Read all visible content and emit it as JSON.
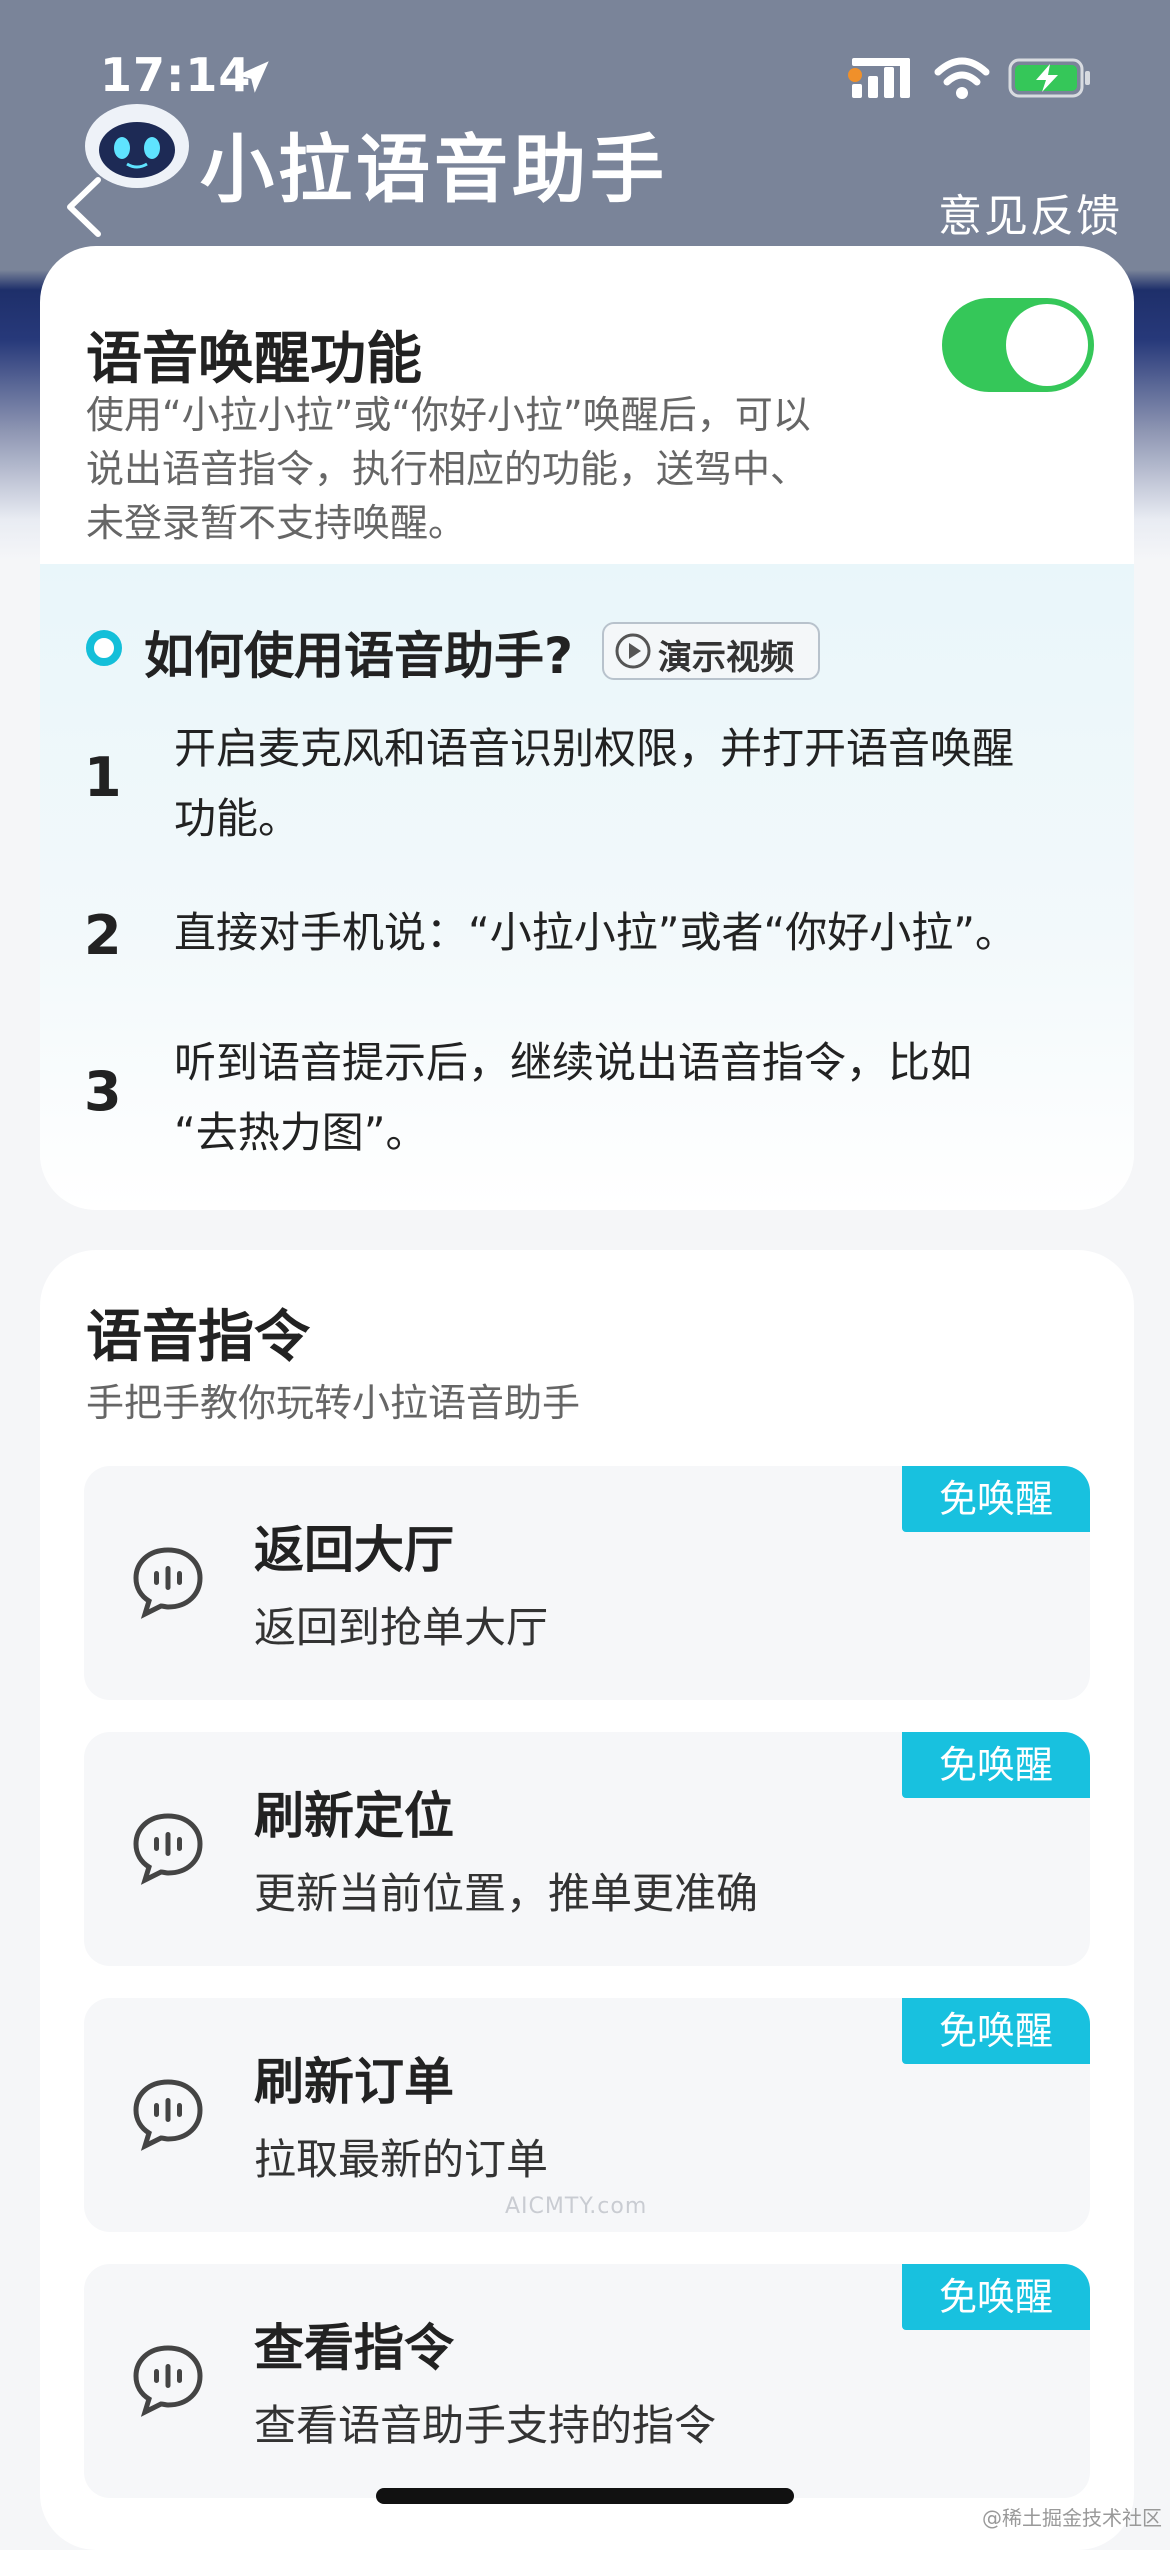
{
  "status_bar": {
    "time": "17:14"
  },
  "header": {
    "title": "小拉语音助手",
    "feedback": "意见反馈"
  },
  "wake": {
    "title": "语音唤醒功能",
    "desc_lines": [
      "使用“小拉小拉”或“你好小拉”唤醒后，可以",
      "说出语音指令，执行相应的功能，送驾中、",
      "未登录暂不支持唤醒。"
    ],
    "enabled": true,
    "toggle_color": "#35c759"
  },
  "howto": {
    "title": "如何使用语音助手?",
    "demo_label": "演示视频",
    "steps": [
      {
        "num": "1",
        "lines": [
          "开启麦克风和语音识别权限，并打开语音唤醒",
          "功能。"
        ]
      },
      {
        "num": "2",
        "lines": [
          "直接对手机说：“小拉小拉”或者“你好小拉”。"
        ]
      },
      {
        "num": "3",
        "lines": [
          "听到语音提示后，继续说出语音指令，比如",
          "“去热力图”。"
        ]
      }
    ]
  },
  "commands": {
    "title": "语音指令",
    "subtitle": "手把手教你玩转小拉语音助手",
    "items": [
      {
        "title": "返回大厅",
        "desc": "返回到抢单大厅",
        "badge": "免唤醒"
      },
      {
        "title": "刷新定位",
        "desc": "更新当前位置，推单更准确",
        "badge": "免唤醒"
      },
      {
        "title": "刷新订单",
        "desc": "拉取最新的订单",
        "badge": "免唤醒"
      },
      {
        "title": "查看指令",
        "desc": "查看语音助手支持的指令",
        "badge": "免唤醒"
      }
    ]
  },
  "watermark": "AICMTY.com",
  "footer_mark": "@稀土掘金技术社区",
  "colors": {
    "accent": "#18c1df",
    "toggle_on": "#35c759",
    "header_bg": "#7a8499"
  }
}
